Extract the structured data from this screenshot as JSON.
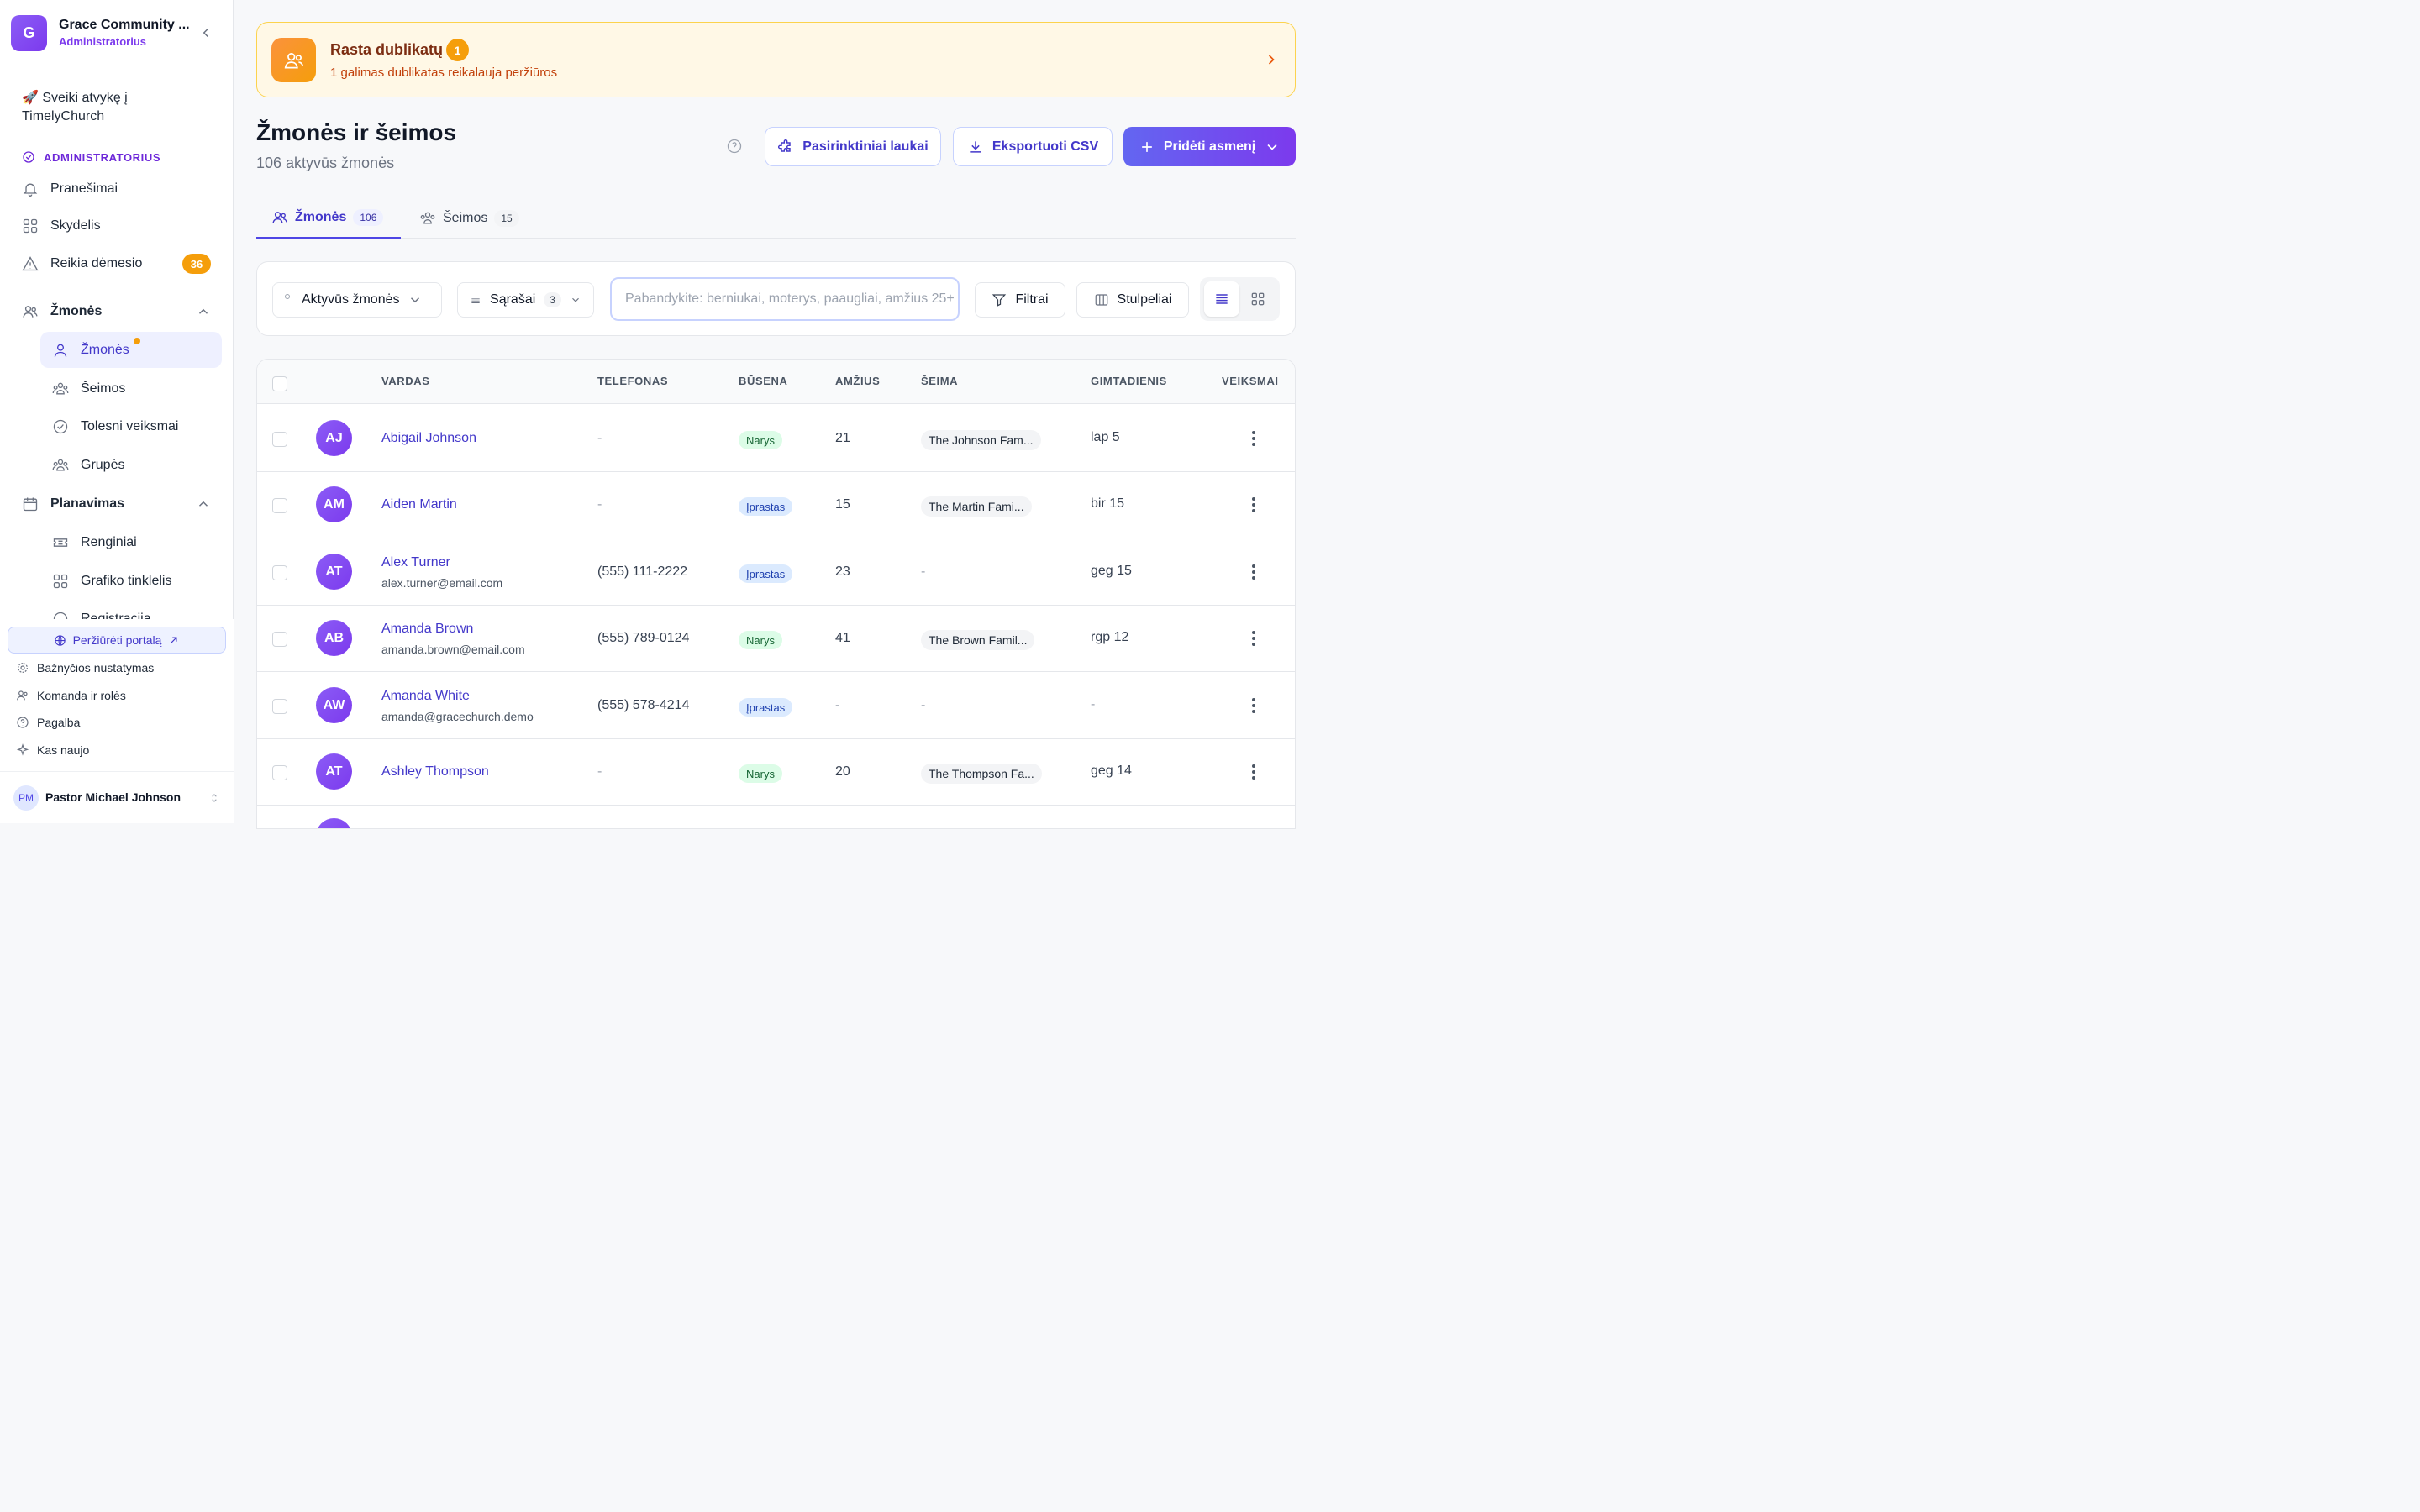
{
  "sidebar": {
    "org_initial": "G",
    "org_name": "Grace Community ...",
    "org_role": "Administratorius",
    "welcome": "🚀 Sveiki atvykę į TimelyChurch",
    "section_label": "ADMINISTRATORIUS",
    "items": {
      "notifications": "Pranešimai",
      "dashboard": "Skydelis",
      "attention": "Reikia dėmesio",
      "attention_count": "36",
      "people_group": "Žmonės",
      "people": "Žmonės",
      "families": "Šeimos",
      "followups": "Tolesni veiksmai",
      "groups": "Grupės",
      "planning_group": "Planavimas",
      "events": "Renginiai",
      "schedule": "Grafiko tinklelis",
      "registration": "Registracija"
    },
    "portal_button": "Peržiūrėti portalą",
    "bottom_links": {
      "church_settings": "Bažnyčios nustatymas",
      "team_roles": "Komanda ir rolės",
      "help": "Pagalba",
      "whats_new": "Kas naujo"
    },
    "user_initials": "PM",
    "user_name": "Pastor Michael Johnson"
  },
  "duplicates": {
    "title": "Rasta dublikatų",
    "count": "1",
    "subtitle": "1 galimas dublikatas reikalauja peržiūros"
  },
  "header": {
    "title": "Žmonės ir šeimos",
    "subtitle": "106 aktyvūs žmonės",
    "custom_fields_button": "Pasirinktiniai laukai",
    "export_button": "Eksportuoti CSV",
    "add_button": "Pridėti asmenį"
  },
  "tabs": {
    "people_label": "Žmonės",
    "people_count": "106",
    "families_label": "Šeimos",
    "families_count": "15"
  },
  "filters": {
    "active_people": "Aktyvūs žmonės",
    "lists_label": "Sąrašai",
    "lists_count": "3",
    "search_placeholder": "Pabandykite: berniukai, moterys, paaugliai, amžius 25+",
    "filters_button": "Filtrai",
    "columns_button": "Stulpeliai"
  },
  "table": {
    "columns": {
      "name": "VARDAS",
      "phone": "TELEFONAS",
      "status": "BŪSENA",
      "age": "AMŽIUS",
      "family": "ŠEIMA",
      "birthday": "GIMTADIENIS",
      "actions": "VEIKSMAI"
    },
    "rows": [
      {
        "initials": "AJ",
        "name": "Abigail Johnson",
        "email": "",
        "phone": "-",
        "status": "Narys",
        "age": "21",
        "family": "The Johnson Fam...",
        "birthday": "lap 5"
      },
      {
        "initials": "AM",
        "name": "Aiden Martin",
        "email": "",
        "phone": "-",
        "status": "Įprastas",
        "age": "15",
        "family": "The Martin Fami...",
        "birthday": "bir 15"
      },
      {
        "initials": "AT",
        "name": "Alex Turner",
        "email": "alex.turner@email.com",
        "phone": "(555) 111-2222",
        "status": "Įprastas",
        "age": "23",
        "family": "-",
        "birthday": "geg 15"
      },
      {
        "initials": "AB",
        "name": "Amanda Brown",
        "email": "amanda.brown@email.com",
        "phone": "(555) 789-0124",
        "status": "Narys",
        "age": "41",
        "family": "The Brown Famil...",
        "birthday": "rgp 12"
      },
      {
        "initials": "AW",
        "name": "Amanda White",
        "email": "amanda@gracechurch.demo",
        "phone": "(555) 578-4214",
        "status": "Įprastas",
        "age": "-",
        "family": "-",
        "birthday": "-"
      },
      {
        "initials": "AT",
        "name": "Ashley Thompson",
        "email": "",
        "phone": "-",
        "status": "Narys",
        "age": "20",
        "family": "The Thompson Fa...",
        "birthday": "geg 14"
      }
    ]
  },
  "colors": {
    "accent": "#4f46e5",
    "brand_purple": "#7c3aed",
    "warning": "#f59e0b"
  }
}
